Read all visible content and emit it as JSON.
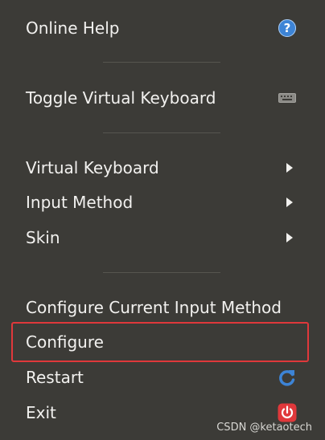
{
  "menu": {
    "online_help": "Online Help",
    "toggle_keyboard": "Toggle Virtual Keyboard",
    "virtual_keyboard": "Virtual Keyboard",
    "input_method": "Input Method",
    "skin": "Skin",
    "configure_current": "Configure Current Input Method",
    "configure": "Configure",
    "restart": "Restart",
    "exit": "Exit"
  },
  "icons": {
    "help": "help-icon",
    "keyboard": "keyboard-icon",
    "submenu": "chevron-right-icon",
    "restart": "refresh-icon",
    "exit": "power-icon"
  },
  "colors": {
    "background": "#3c3b37",
    "text": "#f2f1ef",
    "highlight_border": "#e0383b",
    "help_blue": "#3d84d6",
    "exit_red": "#e0383b"
  },
  "watermark": "CSDN @ketaotech"
}
